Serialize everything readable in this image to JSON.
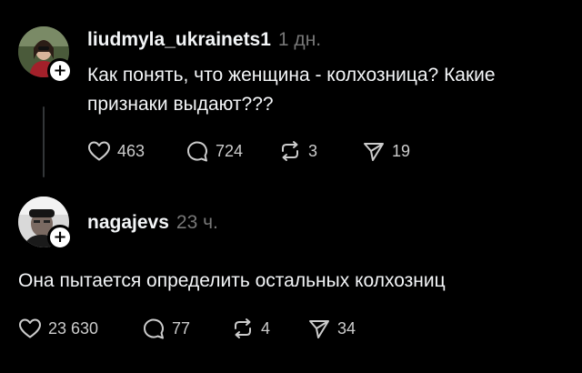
{
  "posts": [
    {
      "username": "liudmyla_ukrainets1",
      "timestamp": "1 дн.",
      "text": "Как понять, что женщина - колхозница? Какие признаки выдают???",
      "likes": "463",
      "replies": "724",
      "reposts": "3",
      "shares": "19"
    },
    {
      "username": "nagajevs",
      "timestamp": "23 ч.",
      "text": "Она пытается определить остальных колхозниц",
      "likes": "23 630",
      "replies": "77",
      "reposts": "4",
      "shares": "34"
    }
  ],
  "icons": {
    "follow": "plus-icon",
    "like": "heart-icon",
    "reply": "comment-icon",
    "repost": "repost-icon",
    "share": "send-icon"
  },
  "colors": {
    "background": "#000000",
    "text": "#f3f5f7",
    "muted": "#777777",
    "thread_line": "#333638"
  }
}
